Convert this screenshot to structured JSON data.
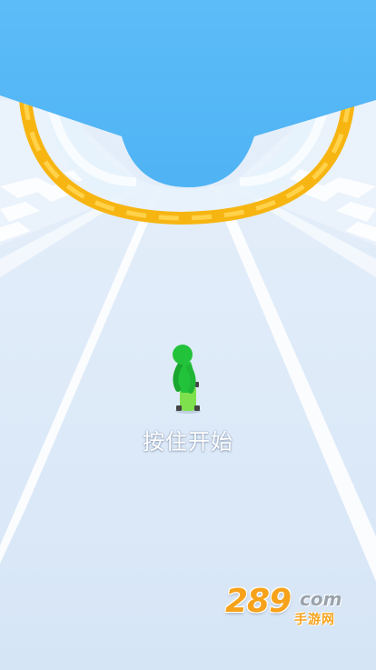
{
  "hud": {
    "start_hint": "按住开始"
  },
  "watermark": {
    "number": "289",
    "suffix": "com",
    "subtitle": "手游网"
  },
  "colors": {
    "sky": "#55b9f7",
    "track": "#dfeaf8",
    "track_lines": "#ffffff",
    "ramp_rail": "#f7b512",
    "player": "#22c33a",
    "skateboard": "#7fe04d"
  }
}
